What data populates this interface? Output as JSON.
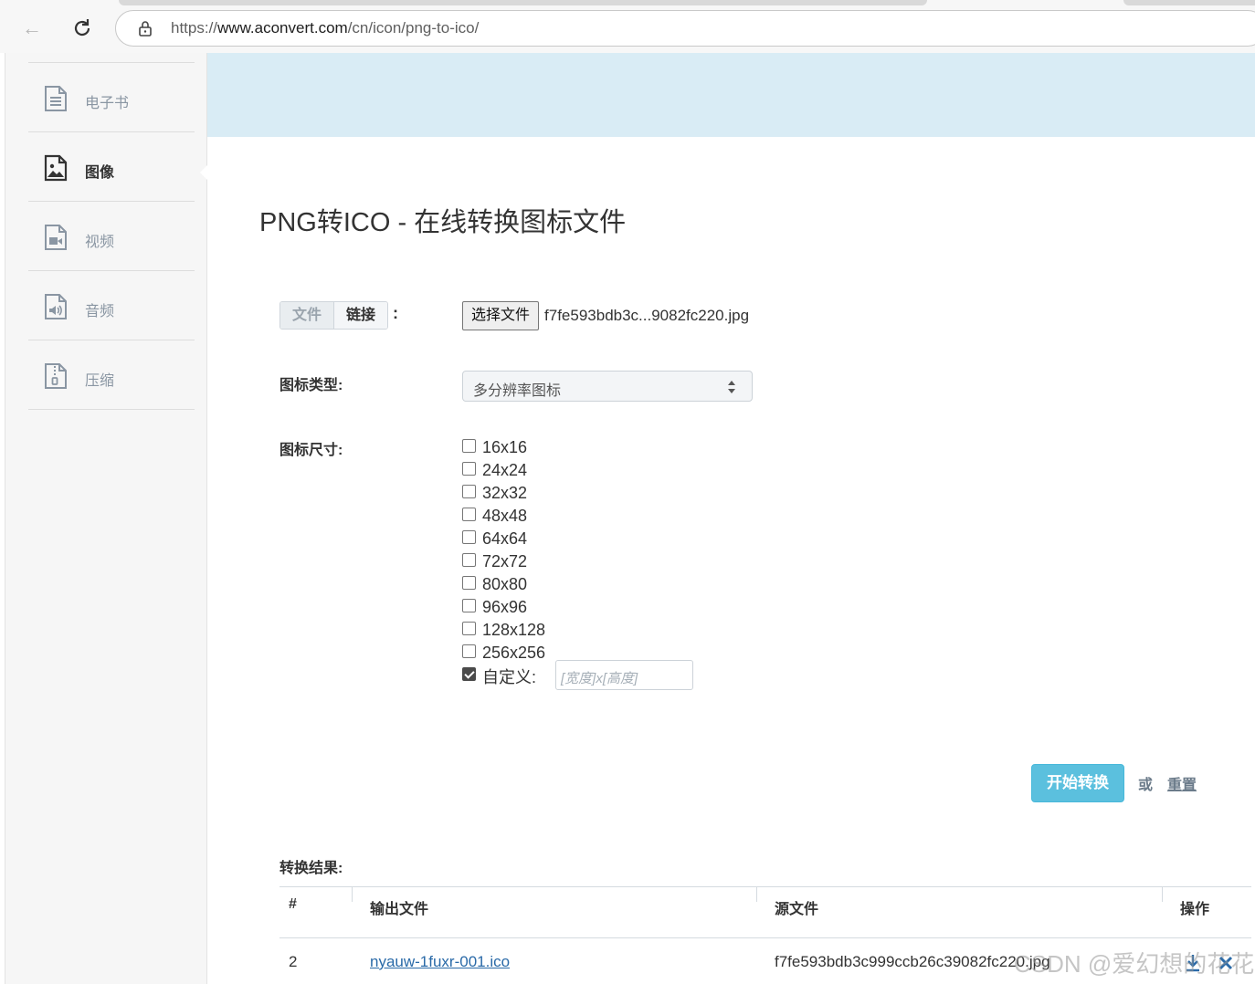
{
  "browser": {
    "url_prefix": "https://",
    "url_host": "www.aconvert.com",
    "url_path": "/cn/icon/png-to-ico/"
  },
  "sidebar": {
    "items": [
      {
        "label": "电子书",
        "icon": "ebook-document-icon"
      },
      {
        "label": "图像",
        "icon": "image-document-icon",
        "active": true
      },
      {
        "label": "视频",
        "icon": "video-document-icon"
      },
      {
        "label": "音频",
        "icon": "audio-document-icon"
      },
      {
        "label": "压缩",
        "icon": "archive-document-icon"
      }
    ]
  },
  "page": {
    "title": "PNG转ICO - 在线转换图标文件"
  },
  "form": {
    "source_tabs": [
      "文件",
      "链接"
    ],
    "source_colon": ":",
    "choose_file_label": "选择文件",
    "file_name": "f7fe593bdb3c...9082fc220.jpg",
    "icon_type_label": "图标类型:",
    "icon_type_value": "多分辨率图标",
    "icon_size_label": "图标尺寸:",
    "sizes": [
      {
        "label": "16x16",
        "checked": false
      },
      {
        "label": "24x24",
        "checked": false
      },
      {
        "label": "32x32",
        "checked": false
      },
      {
        "label": "48x48",
        "checked": false
      },
      {
        "label": "64x64",
        "checked": false
      },
      {
        "label": "72x72",
        "checked": false
      },
      {
        "label": "80x80",
        "checked": false
      },
      {
        "label": "96x96",
        "checked": false
      },
      {
        "label": "128x128",
        "checked": false
      },
      {
        "label": "256x256",
        "checked": false
      },
      {
        "label": "自定义:",
        "checked": true
      }
    ],
    "custom_placeholder": "[宽度]x[高度]",
    "start_label": "开始转换",
    "or_label": "或",
    "reset_label": "重置"
  },
  "results": {
    "label": "转换结果:",
    "headers": [
      "#",
      "输出文件",
      "源文件",
      "操作"
    ],
    "rows": [
      {
        "index": "2",
        "output": "nyauw-1fuxr-001.ico",
        "source": "f7fe593bdb3c999ccb26c39082fc220.jpg"
      }
    ]
  },
  "watermark": "CSDN @爱幻想的花花",
  "colors": {
    "accent": "#5bc0de",
    "banner": "#d9ecf5",
    "link": "#2a6aa8"
  }
}
